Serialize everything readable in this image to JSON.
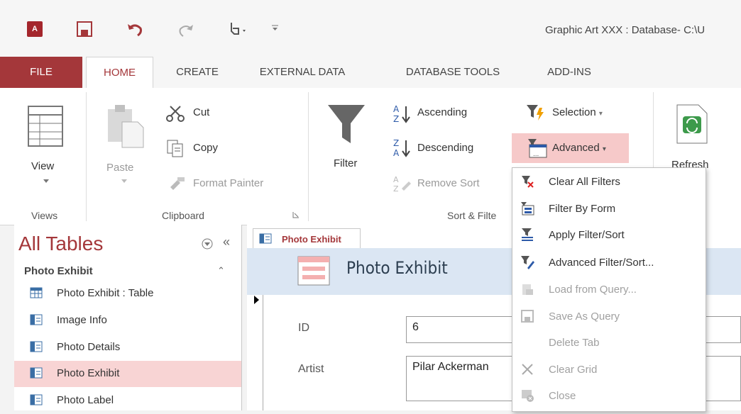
{
  "window": {
    "title": "Graphic Art XXX : Database- C:\\U",
    "app_icon": "A"
  },
  "tabs": [
    "FILE",
    "HOME",
    "CREATE",
    "EXTERNAL DATA",
    "DATABASE TOOLS",
    "ADD-INS"
  ],
  "ribbon": {
    "views": {
      "view_label": "View",
      "group": "Views"
    },
    "clipboard": {
      "paste": "Paste",
      "cut": "Cut",
      "copy": "Copy",
      "format_painter": "Format Painter",
      "group": "Clipboard"
    },
    "sort_filter": {
      "filter": "Filter",
      "ascending": "Ascending",
      "descending": "Descending",
      "remove_sort": "Remove Sort",
      "selection": "Selection",
      "advanced": "Advanced",
      "group": "Sort & Filte"
    },
    "records": {
      "refresh": "Refresh"
    }
  },
  "nav": {
    "title": "All Tables",
    "group": "Photo Exhibit",
    "items": [
      "Photo Exhibit : Table",
      "Image Info",
      "Photo Details",
      "Photo Exhibit",
      "Photo Label"
    ]
  },
  "document": {
    "tab": "Photo Exhibit",
    "form_title": "Photo Exhibit",
    "fields": {
      "id_label": "ID",
      "id_value": "6",
      "artist_label": "Artist",
      "artist_value": "Pilar Ackerman"
    }
  },
  "menu": {
    "items": [
      {
        "label": "Clear All Filters",
        "enabled": true,
        "icon": "clear-filters-icon"
      },
      {
        "label": "Filter By Form",
        "enabled": true,
        "icon": "filter-by-form-icon"
      },
      {
        "label": "Apply Filter/Sort",
        "enabled": true,
        "icon": "apply-filter-icon"
      },
      {
        "label": "Advanced Filter/Sort...",
        "enabled": true,
        "icon": "advanced-filter-icon"
      },
      {
        "label": "Load from Query...",
        "enabled": false,
        "icon": "load-query-icon"
      },
      {
        "label": "Save As Query",
        "enabled": false,
        "icon": "save-query-icon"
      },
      {
        "label": "Delete Tab",
        "enabled": false,
        "icon": ""
      },
      {
        "label": "Clear Grid",
        "enabled": false,
        "icon": "clear-grid-icon"
      },
      {
        "label": "Close",
        "enabled": false,
        "icon": "close-icon"
      }
    ]
  },
  "colors": {
    "accent": "#a4373a",
    "selection": "#f8d4d4",
    "form_header": "#dbe6f3"
  }
}
